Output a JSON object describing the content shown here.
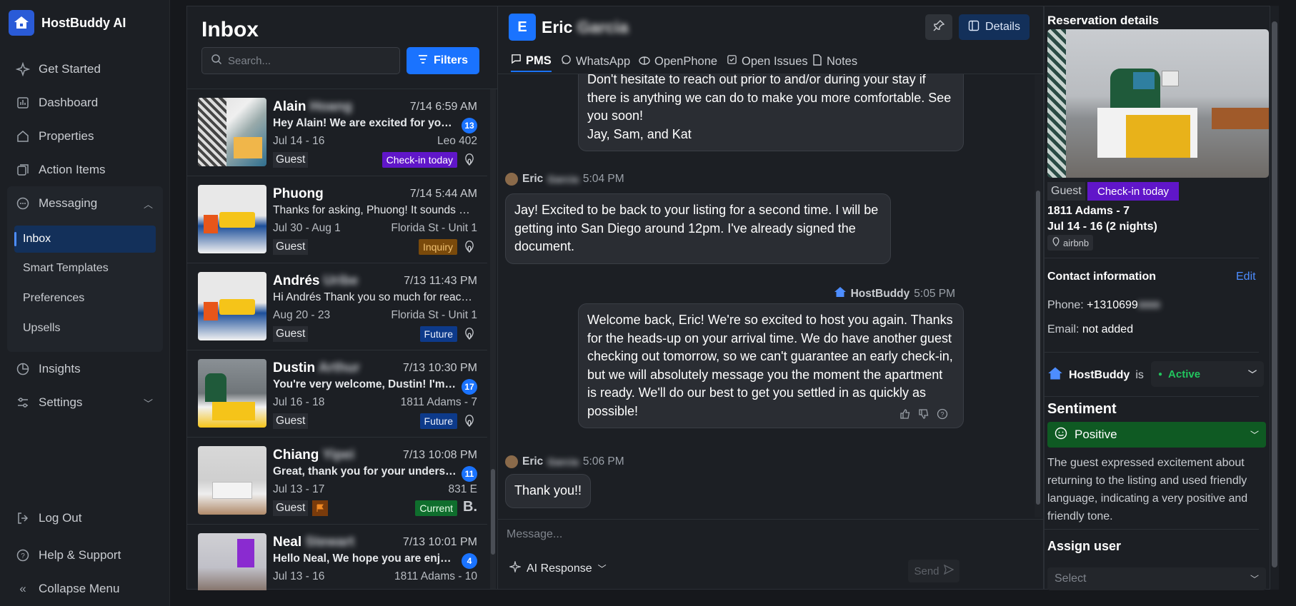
{
  "app": {
    "name": "HostBuddy AI"
  },
  "sidebar": {
    "items": [
      {
        "label": "Get Started",
        "icon": "sparkle-icon"
      },
      {
        "label": "Dashboard",
        "icon": "dashboard-icon"
      },
      {
        "label": "Properties",
        "icon": "home-icon"
      },
      {
        "label": "Action Items",
        "icon": "checklist-icon"
      },
      {
        "label": "Messaging",
        "icon": "chat-icon"
      }
    ],
    "messaging_sub": [
      "Inbox",
      "Smart Templates",
      "Preferences",
      "Upsells"
    ],
    "insights": "Insights",
    "settings": "Settings",
    "log_out": "Log Out",
    "help": "Help & Support",
    "collapse": "Collapse Menu"
  },
  "inbox": {
    "title": "Inbox",
    "search_placeholder": "Search...",
    "filters_label": "Filters",
    "conversations": [
      {
        "name": "Alain",
        "time": "7/14 6:59 AM",
        "message": "Hey Alain! We are excited for your stay",
        "unread": "13",
        "dates": "Jul 14 - 16",
        "property": "Leo 402",
        "guest": "Guest",
        "status": "Check-in today",
        "channel": "airbnb-icon"
      },
      {
        "name": "Phuong",
        "time": "7/14 5:44 AM",
        "message": "Thanks for asking, Phuong! It sounds great",
        "unread": "",
        "dates": "Jul 30 - Aug 1",
        "property": "Florida St - Unit 1",
        "guest": "Guest",
        "status": "Inquiry",
        "channel": "airbnb-icon"
      },
      {
        "name": "Andrés",
        "time": "7/13 11:43 PM",
        "message": "Hi Andrés Thank you so much for reaching out",
        "unread": "",
        "dates": "Aug 20 - 23",
        "property": "Florida St - Unit 1",
        "guest": "Guest",
        "status": "Future",
        "channel": "airbnb-icon"
      },
      {
        "name": "Dustin",
        "time": "7/13 10:30 PM",
        "message": "You're very welcome, Dustin! I'm glad",
        "unread": "17",
        "dates": "Jul 16 - 18",
        "property": "1811 Adams - 7",
        "guest": "Guest",
        "status": "Future",
        "channel": "airbnb-icon"
      },
      {
        "name": "Chiang",
        "time": "7/13 10:08 PM",
        "message": "Great, thank you for your understanding",
        "unread": "11",
        "dates": "Jul 13 - 17",
        "property": "831 E",
        "guest": "Guest",
        "status": "Current",
        "channel": "booking-icon"
      },
      {
        "name": "Neal",
        "time": "7/13 10:01 PM",
        "message": "Hello Neal, We hope you are enjoying",
        "unread": "4",
        "dates": "Jul 13 - 16",
        "property": "1811 Adams - 10",
        "guest": "Guest",
        "status": "",
        "channel": ""
      }
    ]
  },
  "chat": {
    "guest_initial": "E",
    "guest_name": "Eric",
    "details_label": "Details",
    "tabs": [
      "PMS",
      "WhatsApp",
      "OpenPhone",
      "Open Issues",
      "Notes"
    ],
    "messages": [
      {
        "text": "Don't hesitate to reach out prior to and/or during your stay if there is anything we can do to make you more comfortable. See you soon!\nJay, Sam, and Kat"
      },
      {
        "sender": "Eric",
        "time": "5:04 PM",
        "text": "Jay! Excited to be back to your listing for a second time. I will be getting into San Diego around 12pm. I've already signed the document."
      },
      {
        "sender": "HostBuddy",
        "time": "5:05 PM",
        "text": "Welcome back, Eric! We're so excited to host you again. Thanks for the heads-up on your arrival time. We do have another guest checking out tomorrow, so we can't guarantee an early check-in, but we will absolutely message you the moment the apartment is ready. We'll do our best to get you settled in as quickly as possible!"
      },
      {
        "sender": "Eric",
        "time": "5:06 PM",
        "text": "Thank you!!"
      }
    ],
    "composer_placeholder": "Message...",
    "ai_response": "AI Response",
    "send": "Send"
  },
  "details": {
    "reservation_title": "Reservation details",
    "guest": "Guest",
    "status": "Check-in today",
    "property": "1811 Adams - 7",
    "dates": "Jul 14 - 16 (2 nights)",
    "channel": "airbnb",
    "contact_title": "Contact information",
    "edit": "Edit",
    "phone_label": "Phone:",
    "phone": "+1310699",
    "email_label": "Email:",
    "email": "not added",
    "hostbuddy_label": "HostBuddy",
    "is": "is",
    "active": "Active",
    "sentiment_title": "Sentiment",
    "sentiment": "Positive",
    "sentiment_text": "The guest expressed excitement about returning to the listing and used friendly language, indicating a very positive and friendly tone.",
    "assign_title": "Assign user",
    "assign_placeholder": "Select"
  },
  "colors": {
    "accent": "#1a73ff",
    "checkin": "#6016c9",
    "positive": "#0f5a23"
  }
}
